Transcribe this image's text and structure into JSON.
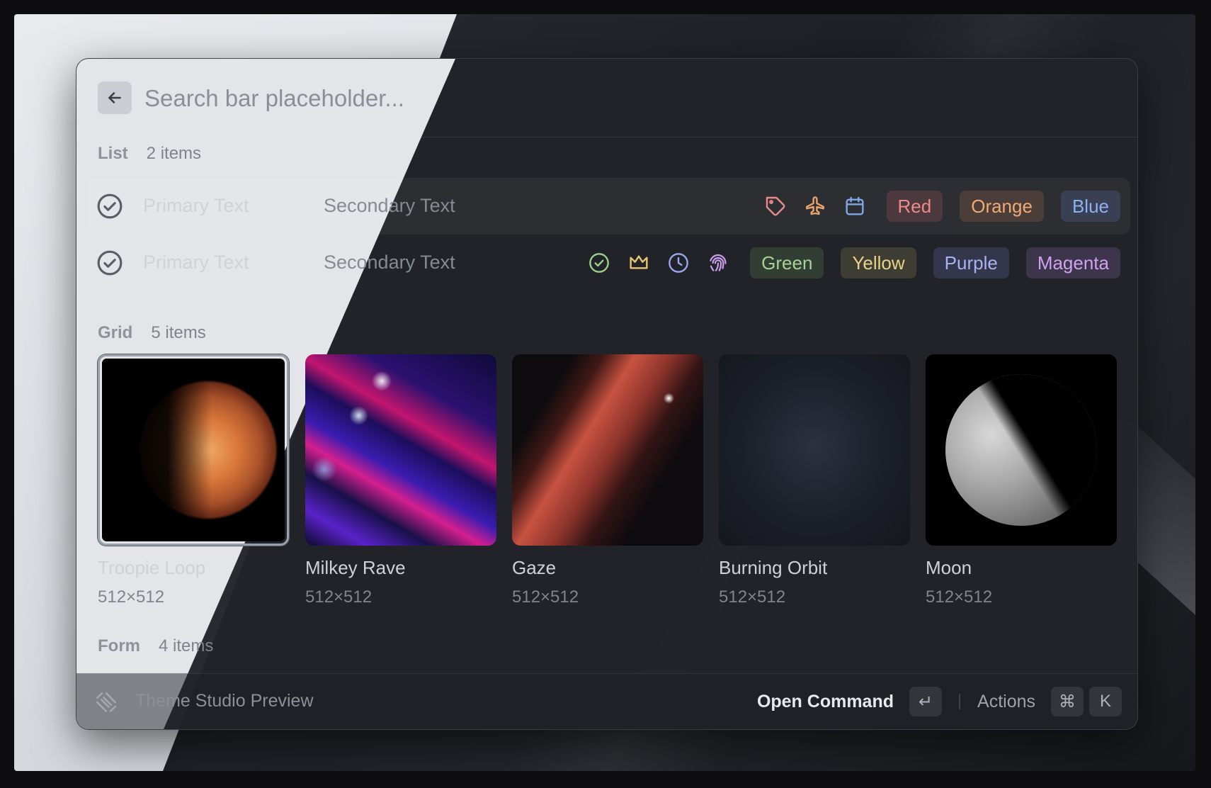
{
  "search": {
    "placeholder": "Search bar placeholder..."
  },
  "list_section": {
    "title": "List",
    "count": "2 items"
  },
  "list": [
    {
      "primary": "Primary Text",
      "secondary": "Secondary Text",
      "icons": [
        {
          "name": "tag-icon",
          "color": "#e98b8b"
        },
        {
          "name": "airplane-icon",
          "color": "#e9a36b"
        },
        {
          "name": "calendar-icon",
          "color": "#7fa6e6"
        }
      ],
      "tags": [
        {
          "label": "Red",
          "color": "#f08a8a",
          "bg": "rgba(240,120,120,0.16)"
        },
        {
          "label": "Orange",
          "color": "#f0aa76",
          "bg": "rgba(240,150,100,0.16)"
        },
        {
          "label": "Blue",
          "color": "#8eb0f0",
          "bg": "rgba(120,150,240,0.18)"
        }
      ]
    },
    {
      "primary": "Primary Text",
      "secondary": "Secondary Text",
      "icons": [
        {
          "name": "check-circle-icon",
          "color": "#9bcf8a"
        },
        {
          "name": "crown-icon",
          "color": "#e6c770"
        },
        {
          "name": "clock-icon",
          "color": "#9aa6ee"
        },
        {
          "name": "fingerprint-icon",
          "color": "#c99be8"
        }
      ],
      "tags": [
        {
          "label": "Green",
          "color": "#a6d494",
          "bg": "rgba(140,200,120,0.16)"
        },
        {
          "label": "Yellow",
          "color": "#e8d28a",
          "bg": "rgba(220,200,110,0.16)"
        },
        {
          "label": "Purple",
          "color": "#a9b2f2",
          "bg": "rgba(140,150,240,0.18)"
        },
        {
          "label": "Magenta",
          "color": "#d0a2ee",
          "bg": "rgba(190,140,240,0.18)"
        }
      ]
    }
  ],
  "grid_section": {
    "title": "Grid",
    "count": "5 items"
  },
  "grid": [
    {
      "title": "Troopie Loop",
      "subtitle": "512×512"
    },
    {
      "title": "Milkey Rave",
      "subtitle": "512×512"
    },
    {
      "title": "Gaze",
      "subtitle": "512×512"
    },
    {
      "title": "Burning Orbit",
      "subtitle": "512×512"
    },
    {
      "title": "Moon",
      "subtitle": "512×512"
    }
  ],
  "form_section": {
    "title": "Form",
    "count": "4 items"
  },
  "footer": {
    "title": "Theme Studio Preview",
    "primary_action": "Open Command",
    "enter_key": "↵",
    "actions_label": "Actions",
    "cmd_key": "⌘",
    "k_key": "K"
  }
}
